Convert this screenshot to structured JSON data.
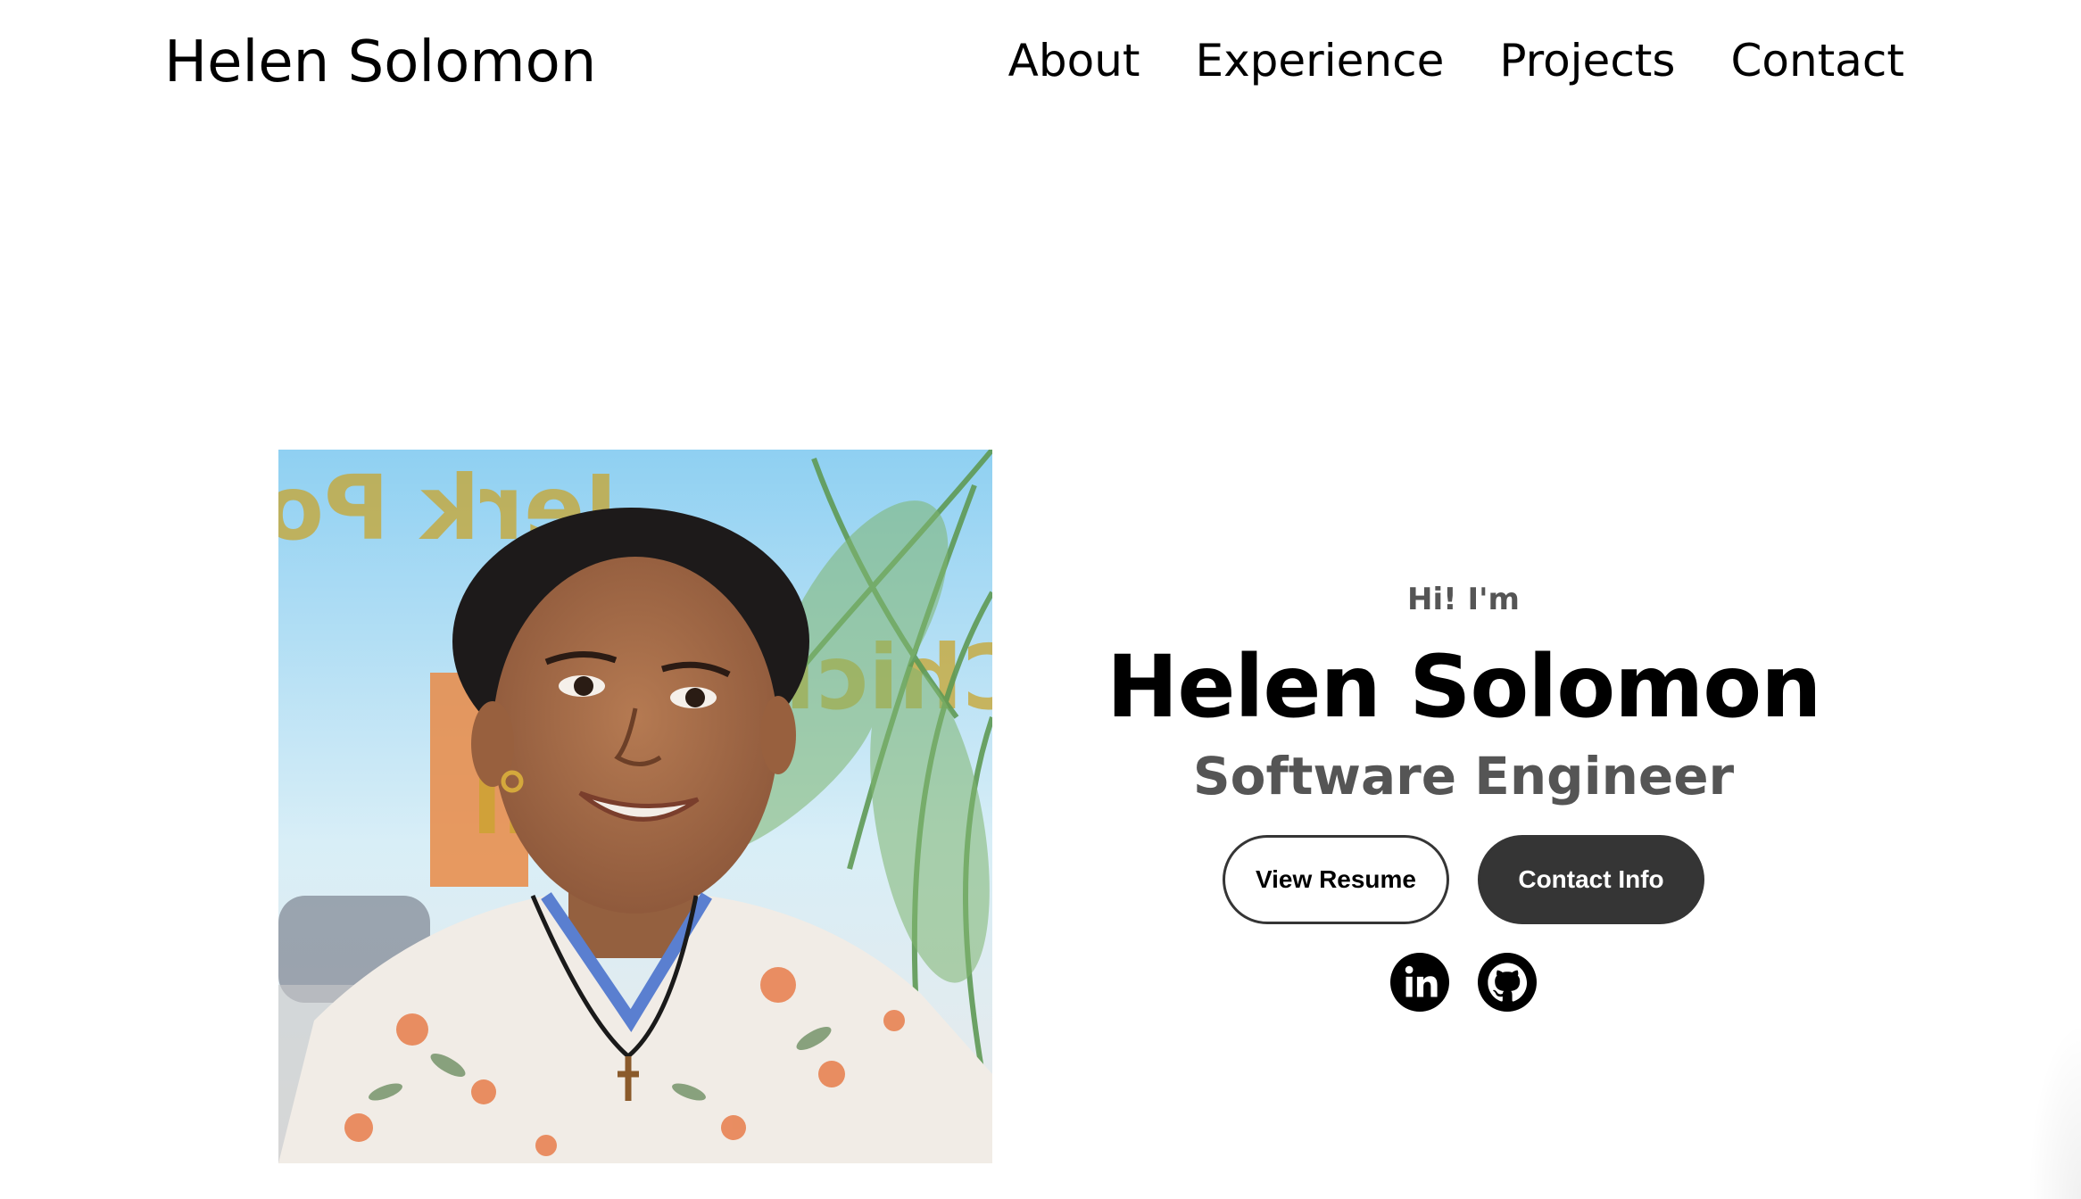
{
  "header": {
    "logo": "Helen Solomon",
    "nav": [
      {
        "label": "About"
      },
      {
        "label": "Experience"
      },
      {
        "label": "Projects"
      },
      {
        "label": "Contact"
      }
    ]
  },
  "hero": {
    "greeting": "Hi! I'm",
    "name": "Helen Solomon",
    "role": "Software Engineer",
    "buttons": {
      "resume": "View Resume",
      "contact": "Contact Info"
    },
    "socials": [
      {
        "icon": "linkedin-icon"
      },
      {
        "icon": "github-icon"
      }
    ],
    "photo": {
      "background_sign_text": [
        "Jerk Pork",
        "Chicken",
        "Oxtail"
      ]
    }
  },
  "colors": {
    "text": "#000000",
    "muted": "#555555",
    "button_dark": "#353535",
    "background": "#ffffff"
  }
}
